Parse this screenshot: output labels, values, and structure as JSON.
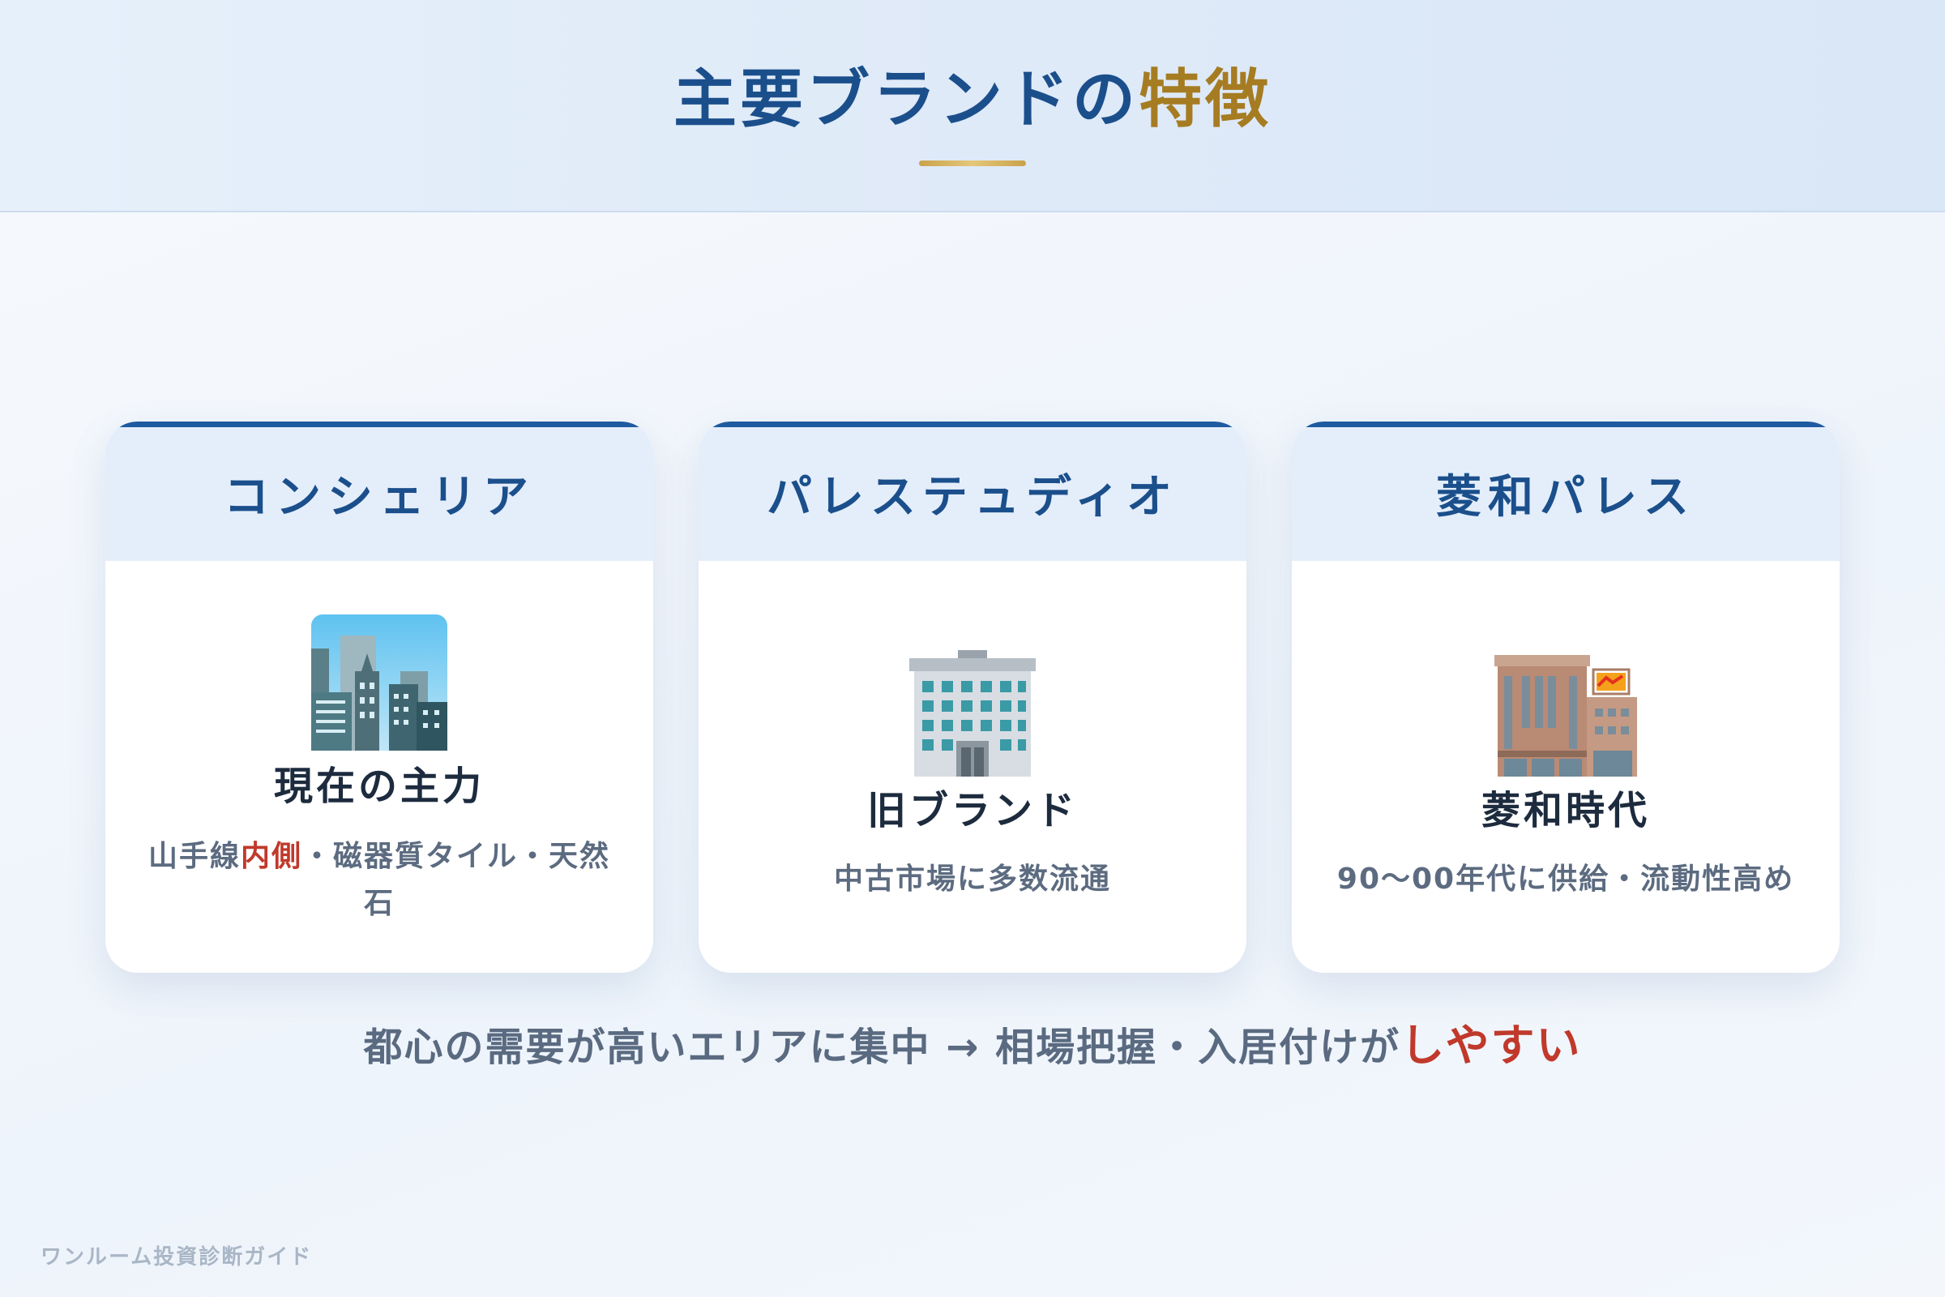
{
  "header": {
    "title_main": "主要ブランドの",
    "title_accent": "特徴"
  },
  "cards": [
    {
      "title": "コンシェリア",
      "icon": "cityscape-icon",
      "subtitle": "現在の主力",
      "desc_pre": "山手線",
      "desc_highlight": "内側",
      "desc_post": "・磁器質タイル・天然石"
    },
    {
      "title": "パレステュディオ",
      "icon": "office-building-icon",
      "subtitle": "旧ブランド",
      "desc": "中古市場に多数流通"
    },
    {
      "title": "菱和パレス",
      "icon": "department-store-icon",
      "subtitle": "菱和時代",
      "desc": "90〜00年代に供給・流動性高め"
    }
  ],
  "summary": {
    "text_main": "都心の需要が高いエリアに集中 → 相場把握・入居付けが",
    "text_highlight": "しやすい"
  },
  "footer": {
    "label": "ワンルーム投資診断ガイド"
  },
  "colors": {
    "primary": "#1b4f8c",
    "accent_gold": "#a67c22",
    "highlight_red": "#c0392b"
  }
}
